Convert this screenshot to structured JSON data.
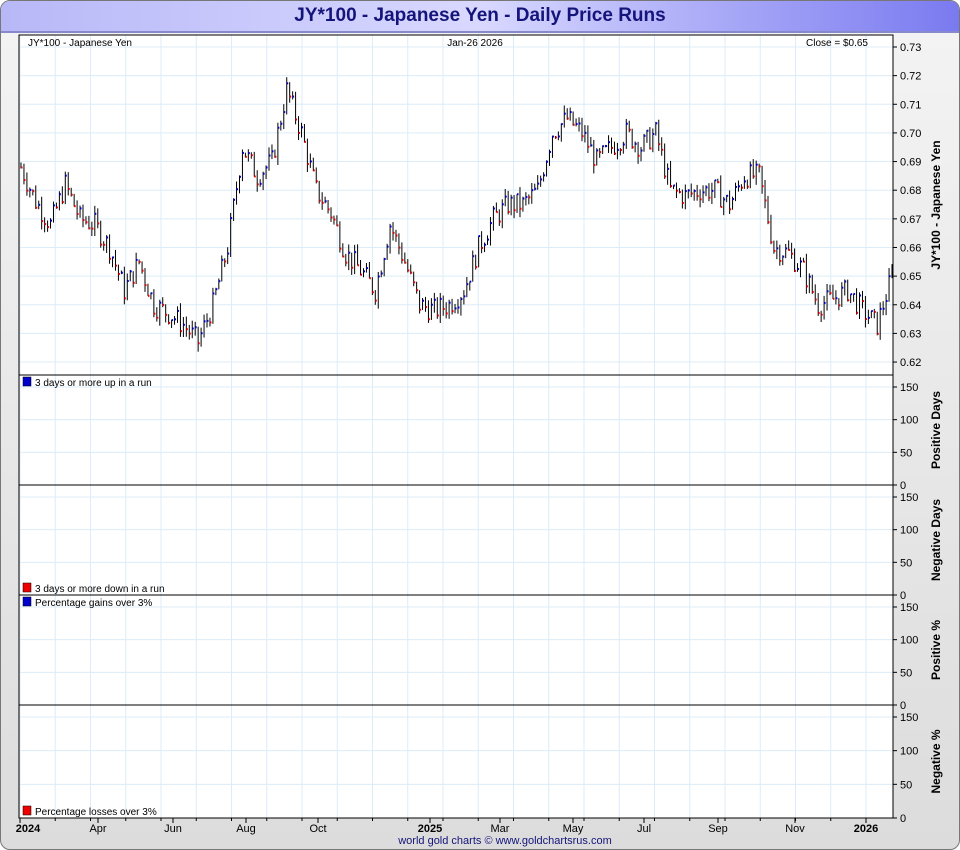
{
  "title": "JY*100  -  Japanese Yen - Daily Price Runs",
  "footer": "world gold charts © www.goldchartsrus.com",
  "colors": {
    "up": "#0000cc",
    "down": "#ee0000",
    "grid": "#dcecf8",
    "title": "#14147a"
  },
  "chart_data": {
    "type": "bar",
    "header": {
      "left": "JY*100  -  Japanese Yen",
      "center": "Jan-26  2026",
      "right": "Close = $0.65"
    },
    "x_ticks": [
      "2024",
      "Apr",
      "Jun",
      "Aug",
      "Oct",
      "2025",
      "Mar",
      "May",
      "Jul",
      "Sep",
      "Nov",
      "2026"
    ],
    "x_range": [
      "2024-01",
      "2026-01-26"
    ],
    "panels": [
      {
        "name": "price",
        "ylabel": "JY*100  -  Japanese Yen",
        "ylim": [
          0.62,
          0.73
        ],
        "ticks": [
          "0.73",
          "0.72",
          "0.71",
          "0.70",
          "0.69",
          "0.68",
          "0.67",
          "0.66",
          "0.65",
          "0.64",
          "0.63",
          "0.62"
        ],
        "semi_monthly_closes": [
          0.688,
          0.676,
          0.668,
          0.682,
          0.67,
          0.668,
          0.66,
          0.645,
          0.655,
          0.64,
          0.637,
          0.633,
          0.627,
          0.64,
          0.66,
          0.695,
          0.685,
          0.69,
          0.715,
          0.7,
          0.68,
          0.672,
          0.658,
          0.652,
          0.645,
          0.668,
          0.655,
          0.64,
          0.638,
          0.64,
          0.645,
          0.66,
          0.67,
          0.675,
          0.675,
          0.68,
          0.7,
          0.705,
          0.7,
          0.69,
          0.695,
          0.7,
          0.695,
          0.7,
          0.68,
          0.678,
          0.68,
          0.68,
          0.675,
          0.685,
          0.685,
          0.66,
          0.658,
          0.652,
          0.64,
          0.642,
          0.645,
          0.638,
          0.633,
          0.65
        ]
      },
      {
        "name": "positive-days",
        "legend": "3 days or more up in a run",
        "ylabel": "Positive Days",
        "ticks": [
          "150",
          "100",
          "50",
          "0"
        ]
      },
      {
        "name": "negative-days",
        "legend": "3 days or more down in a run",
        "ylabel": "Negative Days",
        "ticks": [
          "150",
          "100",
          "50",
          "0"
        ]
      },
      {
        "name": "positive-pct",
        "legend": "Percentage gains over 3%",
        "ylabel": "Positive %",
        "ticks": [
          "150",
          "100",
          "50",
          "0"
        ]
      },
      {
        "name": "negative-pct",
        "legend": "Percentage losses over 3%",
        "ylabel": "Negative %",
        "ticks": [
          "150",
          "100",
          "50",
          "0"
        ]
      }
    ]
  }
}
